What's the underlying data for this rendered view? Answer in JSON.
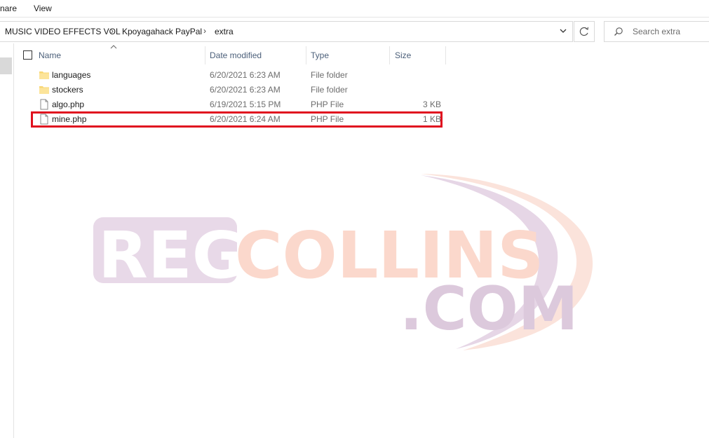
{
  "ribbon": {
    "share_label": "nare",
    "view_label": "View"
  },
  "address": {
    "crumbs": [
      "MUSIC VIDEO EFFECTS VOL",
      "Kpoyagahack PayPal",
      "extra"
    ]
  },
  "search": {
    "placeholder": "Search extra"
  },
  "columns": {
    "name": "Name",
    "date": "Date modified",
    "type": "Type",
    "size": "Size"
  },
  "files": [
    {
      "name": "languages",
      "date": "6/20/2021 6:23 AM",
      "type": "File folder",
      "size": "",
      "icon": "folder-icon"
    },
    {
      "name": "stockers",
      "date": "6/20/2021 6:23 AM",
      "type": "File folder",
      "size": "",
      "icon": "folder-icon"
    },
    {
      "name": "algo.php",
      "date": "6/19/2021 5:15 PM",
      "type": "PHP File",
      "size": "3 KB",
      "icon": "file-icon"
    },
    {
      "name": "mine.php",
      "date": "6/20/2021 6:24 AM",
      "type": "PHP File",
      "size": "1 KB",
      "icon": "file-icon"
    }
  ],
  "highlighted_row": "mine.php",
  "watermark": {
    "line1a": "REG",
    "line1b": "COLLINS",
    "line2": ".COM"
  },
  "colors": {
    "highlight": "#e0111f",
    "folder": "#f8d775",
    "watermark_purple": "#d9c6d9",
    "watermark_peach": "#fbd8cc"
  }
}
